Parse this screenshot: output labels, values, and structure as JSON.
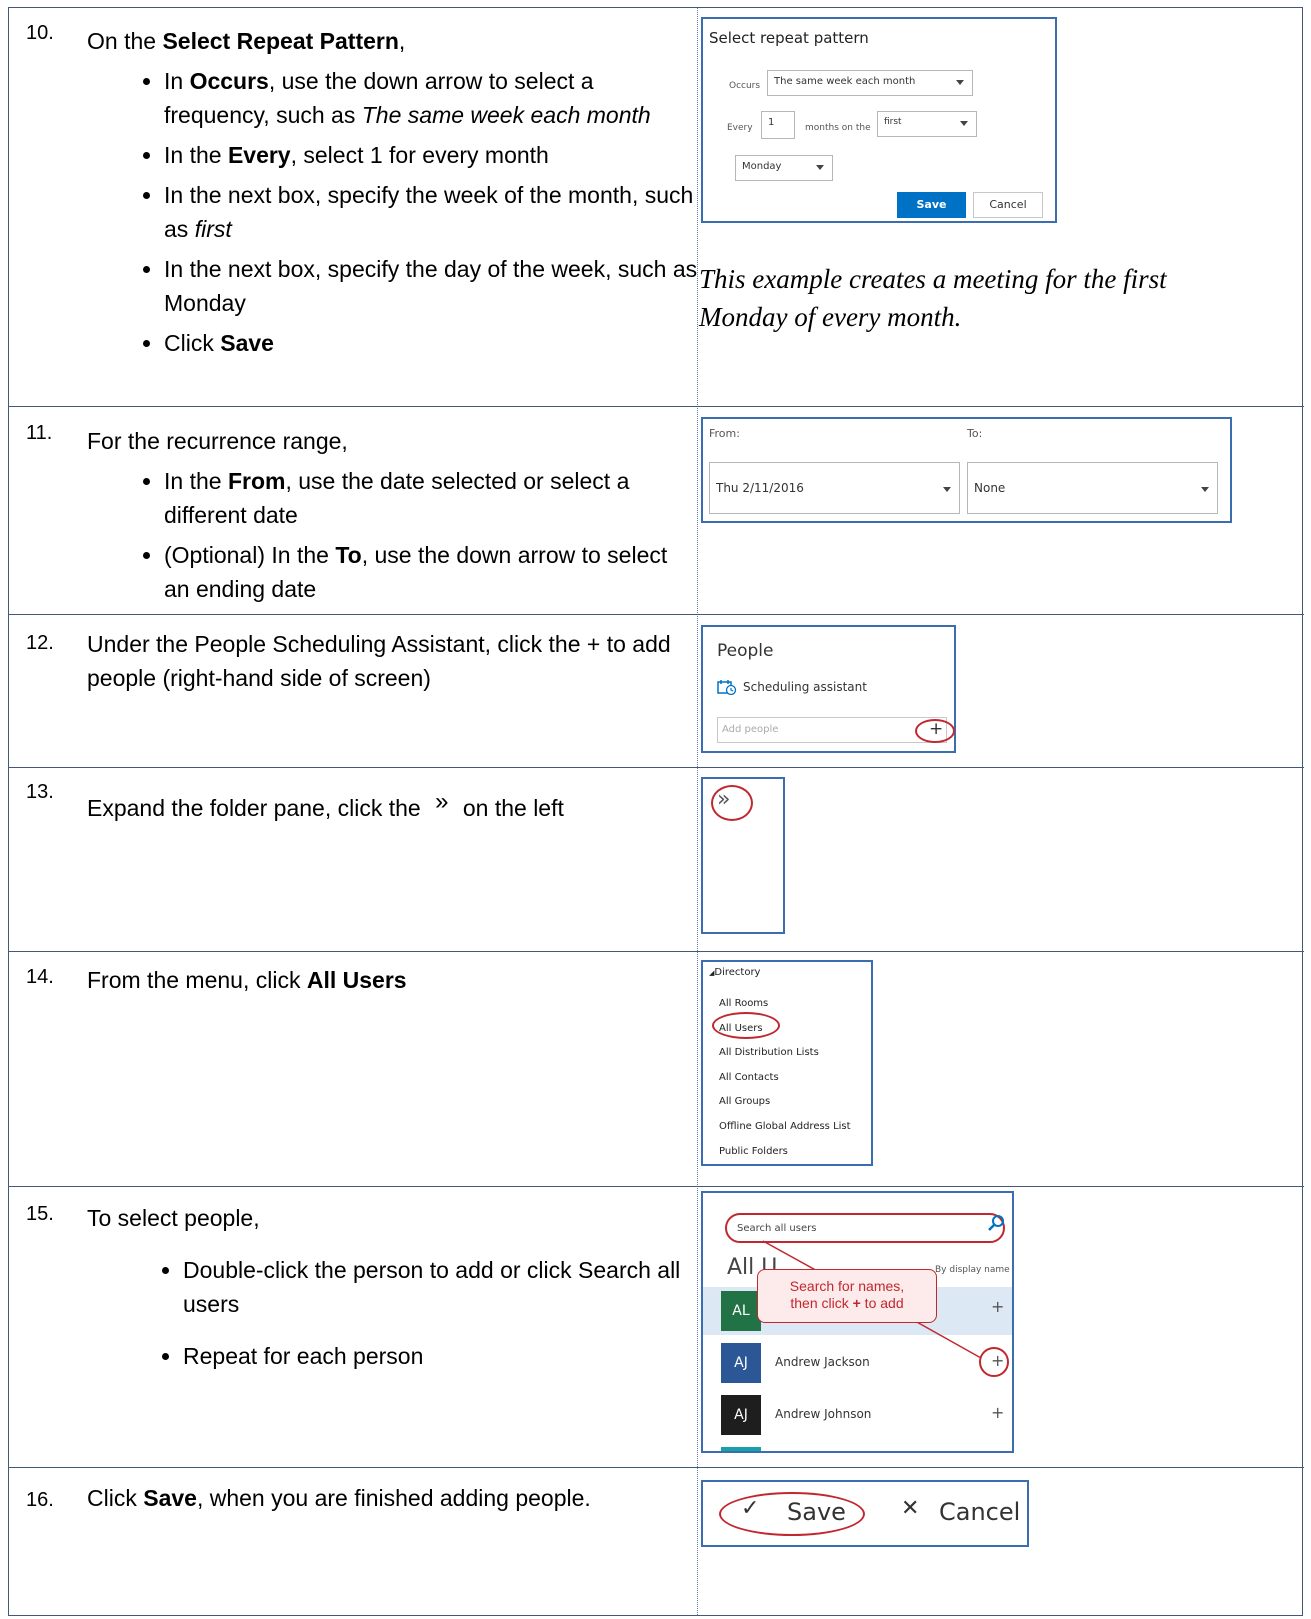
{
  "steps": [
    {
      "number": "10.",
      "lead_prefix": "On the ",
      "lead_bold": "Select Repeat Pattern",
      "lead_suffix": ",",
      "bullets": [
        {
          "a": "In ",
          "b": "Occurs",
          "c": ", use the down arrow to select a frequency, such as ",
          "i": "The same week each month",
          "d": ""
        },
        {
          "a": "In the ",
          "b": "Every",
          "c": ", select 1 for every month",
          "i": "",
          "d": ""
        },
        {
          "a": "In the next box, specify the week of the month, such as ",
          "b": "",
          "c": "",
          "i": "first",
          "d": ""
        },
        {
          "a": "In the next box, specify the day of the week, such as Monday",
          "b": "",
          "c": "",
          "i": "",
          "d": ""
        },
        {
          "a": "Click ",
          "b": "Save",
          "c": "",
          "i": "",
          "d": ""
        }
      ],
      "dialog": {
        "title": "Select repeat pattern",
        "occurs_label": "Occurs",
        "occurs_value": "The same week each month",
        "every_label": "Every",
        "every_value": "1",
        "months_on_the": "months on the",
        "week_value": "first",
        "day_value": "Monday",
        "save_label": "Save",
        "cancel_label": "Cancel"
      },
      "note": "This example creates a meeting for the first Monday of every month."
    },
    {
      "number": "11.",
      "lead": "For the recurrence range,",
      "bullets": [
        {
          "a": "In the ",
          "b": "From",
          "c": ", use the date selected or select a different date"
        },
        {
          "a": "(Optional) In the ",
          "b": "To",
          "c": ", use the down arrow to select an ending date"
        }
      ],
      "range": {
        "from_label": "From:",
        "from_value": "Thu 2/11/2016",
        "to_label": "To:",
        "to_value": "None"
      }
    },
    {
      "number": "12.",
      "text": "Under the People Scheduling Assistant, click the + to add people (right-hand side of screen)",
      "people": {
        "title": "People",
        "assistant": "Scheduling assistant",
        "placeholder": "Add people",
        "plus": "+"
      }
    },
    {
      "number": "13.",
      "text_before": "Expand the folder pane, click the ",
      "glyph": "»",
      "text_after": " on the left",
      "pane_glyph": "»"
    },
    {
      "number": "14.",
      "text_prefix": "From the menu, click ",
      "text_bold": "All Users",
      "directory": {
        "header": "Directory",
        "items": [
          "All Rooms",
          "All Users",
          "All Distribution Lists",
          "All Contacts",
          "All Groups",
          "Offline Global Address List",
          "Public Folders"
        ]
      }
    },
    {
      "number": "15.",
      "lead": "To select people,",
      "bullets": [
        "Double-click the person to add or click Search all users",
        "Repeat for each person"
      ],
      "users": {
        "search_placeholder": "Search all users",
        "heading": "All Users",
        "sort": "By display name",
        "callout_line1": "Search for names,",
        "callout_line2_a": "then click ",
        "callout_line2_b": "+",
        "callout_line2_c": " to add",
        "rows": [
          {
            "initials": "AL",
            "name": "",
            "color": "#217346"
          },
          {
            "initials": "AJ",
            "name": "Andrew Jackson",
            "color": "#2b5797"
          },
          {
            "initials": "AJ",
            "name": "Andrew Johnson",
            "color": "#1e1e1e"
          }
        ],
        "plus": "+"
      }
    },
    {
      "number": "16.",
      "text_prefix": "Click ",
      "text_bold": "Save",
      "text_suffix": ", when you are finished adding people.",
      "buttons": {
        "save_label": "Save",
        "cancel_label": "Cancel",
        "check": "✓",
        "x": "✕"
      }
    }
  ],
  "colors": {
    "panel_border": "#3b6db1",
    "grid_border": "#44587a",
    "highlight_red": "#c0282f",
    "primary_blue": "#0072c6"
  }
}
